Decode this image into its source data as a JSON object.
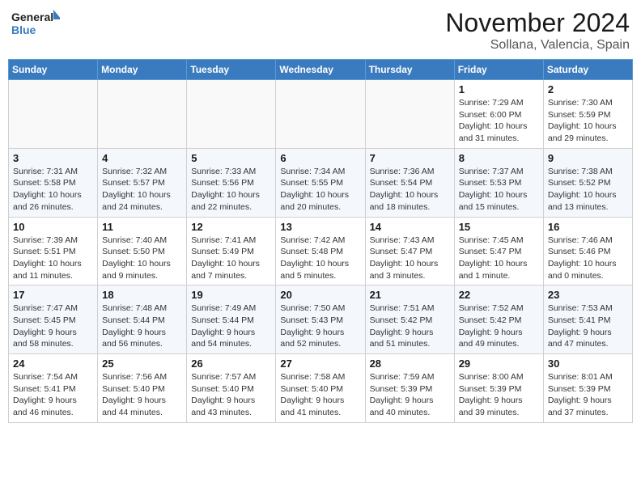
{
  "header": {
    "logo_general": "General",
    "logo_blue": "Blue",
    "month_year": "November 2024",
    "location": "Sollana, Valencia, Spain"
  },
  "weekdays": [
    "Sunday",
    "Monday",
    "Tuesday",
    "Wednesday",
    "Thursday",
    "Friday",
    "Saturday"
  ],
  "weeks": [
    [
      {
        "day": "",
        "info": ""
      },
      {
        "day": "",
        "info": ""
      },
      {
        "day": "",
        "info": ""
      },
      {
        "day": "",
        "info": ""
      },
      {
        "day": "",
        "info": ""
      },
      {
        "day": "1",
        "info": "Sunrise: 7:29 AM\nSunset: 6:00 PM\nDaylight: 10 hours\nand 31 minutes."
      },
      {
        "day": "2",
        "info": "Sunrise: 7:30 AM\nSunset: 5:59 PM\nDaylight: 10 hours\nand 29 minutes."
      }
    ],
    [
      {
        "day": "3",
        "info": "Sunrise: 7:31 AM\nSunset: 5:58 PM\nDaylight: 10 hours\nand 26 minutes."
      },
      {
        "day": "4",
        "info": "Sunrise: 7:32 AM\nSunset: 5:57 PM\nDaylight: 10 hours\nand 24 minutes."
      },
      {
        "day": "5",
        "info": "Sunrise: 7:33 AM\nSunset: 5:56 PM\nDaylight: 10 hours\nand 22 minutes."
      },
      {
        "day": "6",
        "info": "Sunrise: 7:34 AM\nSunset: 5:55 PM\nDaylight: 10 hours\nand 20 minutes."
      },
      {
        "day": "7",
        "info": "Sunrise: 7:36 AM\nSunset: 5:54 PM\nDaylight: 10 hours\nand 18 minutes."
      },
      {
        "day": "8",
        "info": "Sunrise: 7:37 AM\nSunset: 5:53 PM\nDaylight: 10 hours\nand 15 minutes."
      },
      {
        "day": "9",
        "info": "Sunrise: 7:38 AM\nSunset: 5:52 PM\nDaylight: 10 hours\nand 13 minutes."
      }
    ],
    [
      {
        "day": "10",
        "info": "Sunrise: 7:39 AM\nSunset: 5:51 PM\nDaylight: 10 hours\nand 11 minutes."
      },
      {
        "day": "11",
        "info": "Sunrise: 7:40 AM\nSunset: 5:50 PM\nDaylight: 10 hours\nand 9 minutes."
      },
      {
        "day": "12",
        "info": "Sunrise: 7:41 AM\nSunset: 5:49 PM\nDaylight: 10 hours\nand 7 minutes."
      },
      {
        "day": "13",
        "info": "Sunrise: 7:42 AM\nSunset: 5:48 PM\nDaylight: 10 hours\nand 5 minutes."
      },
      {
        "day": "14",
        "info": "Sunrise: 7:43 AM\nSunset: 5:47 PM\nDaylight: 10 hours\nand 3 minutes."
      },
      {
        "day": "15",
        "info": "Sunrise: 7:45 AM\nSunset: 5:47 PM\nDaylight: 10 hours\nand 1 minute."
      },
      {
        "day": "16",
        "info": "Sunrise: 7:46 AM\nSunset: 5:46 PM\nDaylight: 10 hours\nand 0 minutes."
      }
    ],
    [
      {
        "day": "17",
        "info": "Sunrise: 7:47 AM\nSunset: 5:45 PM\nDaylight: 9 hours\nand 58 minutes."
      },
      {
        "day": "18",
        "info": "Sunrise: 7:48 AM\nSunset: 5:44 PM\nDaylight: 9 hours\nand 56 minutes."
      },
      {
        "day": "19",
        "info": "Sunrise: 7:49 AM\nSunset: 5:44 PM\nDaylight: 9 hours\nand 54 minutes."
      },
      {
        "day": "20",
        "info": "Sunrise: 7:50 AM\nSunset: 5:43 PM\nDaylight: 9 hours\nand 52 minutes."
      },
      {
        "day": "21",
        "info": "Sunrise: 7:51 AM\nSunset: 5:42 PM\nDaylight: 9 hours\nand 51 minutes."
      },
      {
        "day": "22",
        "info": "Sunrise: 7:52 AM\nSunset: 5:42 PM\nDaylight: 9 hours\nand 49 minutes."
      },
      {
        "day": "23",
        "info": "Sunrise: 7:53 AM\nSunset: 5:41 PM\nDaylight: 9 hours\nand 47 minutes."
      }
    ],
    [
      {
        "day": "24",
        "info": "Sunrise: 7:54 AM\nSunset: 5:41 PM\nDaylight: 9 hours\nand 46 minutes."
      },
      {
        "day": "25",
        "info": "Sunrise: 7:56 AM\nSunset: 5:40 PM\nDaylight: 9 hours\nand 44 minutes."
      },
      {
        "day": "26",
        "info": "Sunrise: 7:57 AM\nSunset: 5:40 PM\nDaylight: 9 hours\nand 43 minutes."
      },
      {
        "day": "27",
        "info": "Sunrise: 7:58 AM\nSunset: 5:40 PM\nDaylight: 9 hours\nand 41 minutes."
      },
      {
        "day": "28",
        "info": "Sunrise: 7:59 AM\nSunset: 5:39 PM\nDaylight: 9 hours\nand 40 minutes."
      },
      {
        "day": "29",
        "info": "Sunrise: 8:00 AM\nSunset: 5:39 PM\nDaylight: 9 hours\nand 39 minutes."
      },
      {
        "day": "30",
        "info": "Sunrise: 8:01 AM\nSunset: 5:39 PM\nDaylight: 9 hours\nand 37 minutes."
      }
    ]
  ]
}
